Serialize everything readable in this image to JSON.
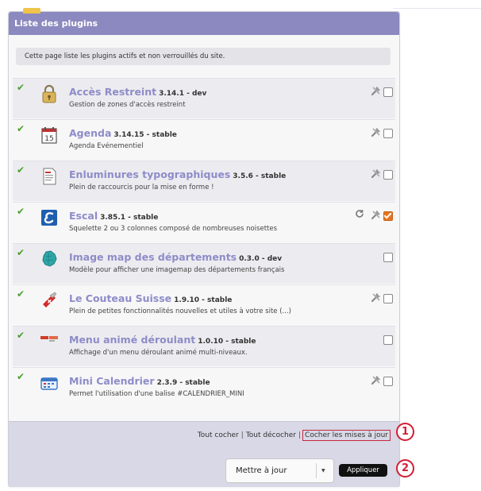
{
  "panel": {
    "title": "Liste des plugins",
    "intro": "Cette page liste les plugins actifs et non verrouillés du site."
  },
  "plugins": [
    {
      "name": "Accès Restreint",
      "version": "3.14.1 - dev",
      "description": "Gestion de zones d'accès restreint",
      "icon": "padlock-icon",
      "checked": false,
      "has_tools": true,
      "has_refresh": false
    },
    {
      "name": "Agenda",
      "version": "3.14.15 - stable",
      "description": "Agenda Evénementiel",
      "icon": "calendar-icon",
      "icon_text": "15",
      "checked": false,
      "has_tools": true,
      "has_refresh": false
    },
    {
      "name": "Enluminures typographiques",
      "version": "3.5.6 - stable",
      "description": "Plein de raccourcis pour la mise en forme !",
      "icon": "document-icon",
      "checked": false,
      "has_tools": true,
      "has_refresh": false
    },
    {
      "name": "Escal",
      "version": "3.85.1 - stable",
      "description": "Squelette 2 ou 3 colonnes composé de nombreuses noisettes",
      "icon": "escal-logo-icon",
      "checked": true,
      "has_tools": true,
      "has_refresh": true
    },
    {
      "name": "Image map des départements",
      "version": "0.3.0 - dev",
      "description": "Modèle pour afficher une imagemap des départements français",
      "icon": "france-map-icon",
      "checked": false,
      "has_tools": false,
      "has_refresh": false
    },
    {
      "name": "Le Couteau Suisse",
      "version": "1.9.10 - stable",
      "description": "Plein de petites fonctionnalités nouvelles et utiles à votre site (...)",
      "icon": "swiss-knife-icon",
      "checked": false,
      "has_tools": true,
      "has_refresh": false
    },
    {
      "name": "Menu animé déroulant",
      "version": "1.0.10 - stable",
      "description": "Affichage d'un menu déroulant animé multi-niveaux.",
      "icon": "menu-bar-icon",
      "checked": false,
      "has_tools": false,
      "has_refresh": false
    },
    {
      "name": "Mini Calendrier",
      "version": "2.3.9 - stable",
      "description": "Permet l'utilisation d'une balise #CALENDRIER_MINI",
      "icon": "mini-calendar-icon",
      "checked": false,
      "has_tools": true,
      "has_refresh": false
    }
  ],
  "footer": {
    "check_all": "Tout cocher",
    "uncheck_all": "Tout décocher",
    "check_updates": "Cocher les mises à jour",
    "select_value": "Mettre à jour",
    "apply_label": "Appliquer",
    "badge_1": "1",
    "badge_2": "2"
  },
  "colors": {
    "header": "#8b89bf",
    "plugin_name": "#8e8cc8",
    "check": "#4aa02c",
    "badge": "#d41e34",
    "checked_box": "#e8731f"
  }
}
